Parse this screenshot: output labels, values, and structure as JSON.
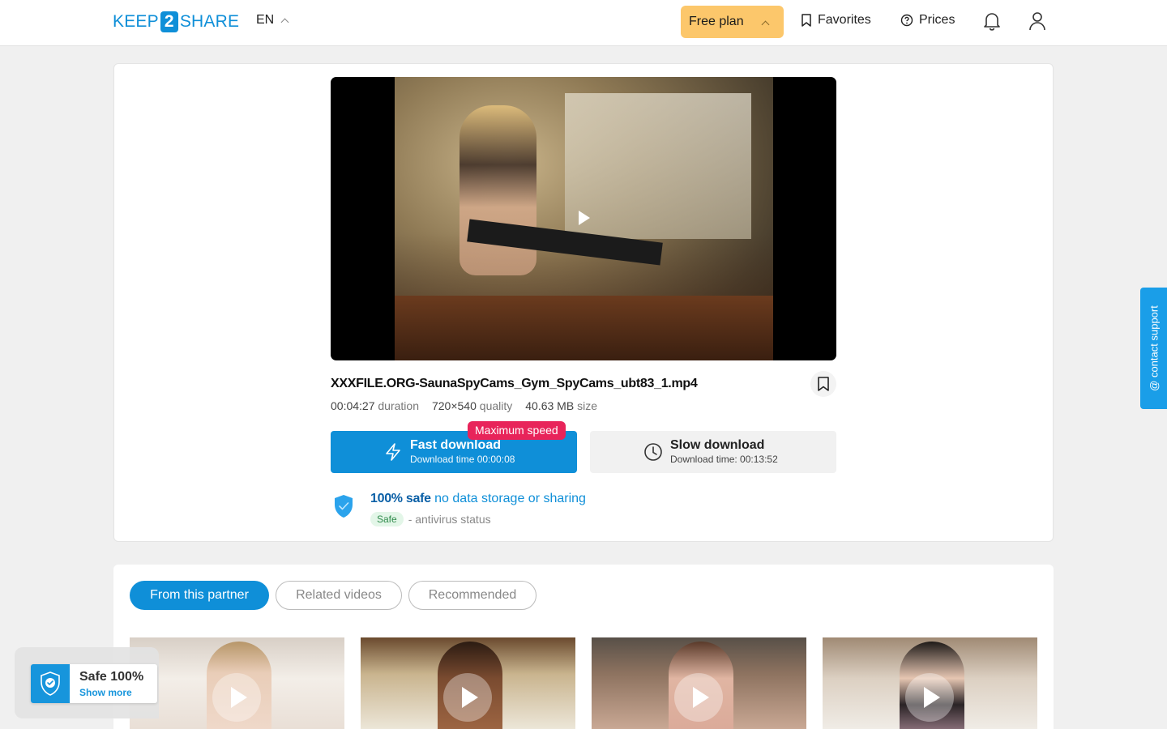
{
  "header": {
    "logo_left": "KEEP",
    "logo_mid": "2",
    "logo_right": "SHARE",
    "language": "EN",
    "plan_label": "Free plan",
    "favorites_label": "Favorites",
    "prices_label": "Prices"
  },
  "file": {
    "name": "XXXFILE.ORG-SaunaSpyCams_Gym_SpyCams_ubt83_1.mp4",
    "duration_value": "00:04:27",
    "duration_label": "duration",
    "quality_value": "720×540",
    "quality_label": "quality",
    "size_value": "40.63 MB",
    "size_label": "size"
  },
  "download": {
    "badge": "Maximum speed",
    "fast_title": "Fast download",
    "fast_time": "Download time 00:00:08",
    "slow_title": "Slow download",
    "slow_time": "Download time: 00:13:52"
  },
  "safety": {
    "safe_bold": "100% safe",
    "safe_rest": " no data storage or sharing",
    "status_pill": "Safe",
    "status_text": "- antivirus status"
  },
  "support": {
    "label": "@ contact support"
  },
  "tabs": [
    {
      "label": "From this partner"
    },
    {
      "label": "Related videos"
    },
    {
      "label": "Recommended"
    }
  ],
  "safe_badge": {
    "title": "Safe 100%",
    "link": "Show more"
  },
  "colors": {
    "brand": "#0f8fd8",
    "plan": "#fcc76b",
    "alert": "#e8245a"
  }
}
